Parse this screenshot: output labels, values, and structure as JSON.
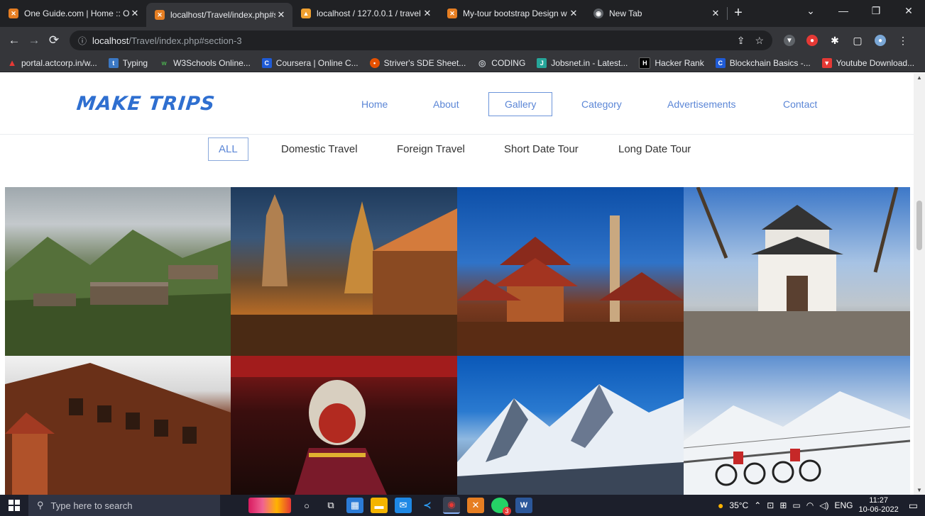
{
  "tabs": [
    {
      "label": "One Guide.com | Home :: On",
      "favicon": "xampp-icon",
      "color": "#e67e22",
      "active": false
    },
    {
      "label": "localhost/Travel/index.php#s",
      "favicon": "xampp-icon",
      "color": "#e67e22",
      "active": true
    },
    {
      "label": "localhost / 127.0.0.1 / travel /",
      "favicon": "phpmyadmin-icon",
      "color": "#f0a030",
      "active": false
    },
    {
      "label": "My-tour bootstrap Design w",
      "favicon": "xampp-icon",
      "color": "#e67e22",
      "active": false
    },
    {
      "label": "New Tab",
      "favicon": "chrome-icon",
      "color": "#9aa0a6",
      "active": false
    }
  ],
  "address": {
    "host": "localhost",
    "path": "/Travel/index.php#section-3"
  },
  "bookmarks": [
    {
      "label": "portal.actcorp.in/w...",
      "color": "#e53935",
      "glyph": "▲"
    },
    {
      "label": "Typing",
      "color": "#3b78c4",
      "glyph": "t"
    },
    {
      "label": "W3Schools Online...",
      "color": "#4caf50",
      "glyph": "w"
    },
    {
      "label": "Coursera | Online C...",
      "color": "#1f5bd6",
      "glyph": "C"
    },
    {
      "label": "Striver's SDE Sheet...",
      "color": "#e65100",
      "glyph": "•"
    },
    {
      "label": "CODING",
      "color": "#5f6368",
      "glyph": "◎"
    },
    {
      "label": "Jobsnet.in - Latest...",
      "color": "#26a69a",
      "glyph": "J"
    },
    {
      "label": "Hacker Rank",
      "color": "#111111",
      "glyph": "H"
    },
    {
      "label": "Blockchain Basics -...",
      "color": "#1f5bd6",
      "glyph": "C"
    },
    {
      "label": "Youtube Download...",
      "color": "#e53935",
      "glyph": "▼"
    }
  ],
  "site": {
    "logo": "MAKE TRIPS",
    "nav": [
      {
        "label": "Home",
        "active": false
      },
      {
        "label": "About",
        "active": false
      },
      {
        "label": "Gallery",
        "active": true
      },
      {
        "label": "Category",
        "active": false
      },
      {
        "label": "Advertisements",
        "active": false
      },
      {
        "label": "Contact",
        "active": false
      }
    ],
    "filters": [
      {
        "label": "ALL",
        "active": true
      },
      {
        "label": "Domestic Travel",
        "active": false
      },
      {
        "label": "Foreign Travel",
        "active": false
      },
      {
        "label": "Short Date Tour",
        "active": false
      },
      {
        "label": "Long Date Tour",
        "active": false
      }
    ]
  },
  "taskbar": {
    "search_placeholder": "Type here to search",
    "weather": "35°C",
    "language": "ENG",
    "time": "11:27",
    "date": "10-06-2022",
    "notification_count": "3"
  }
}
